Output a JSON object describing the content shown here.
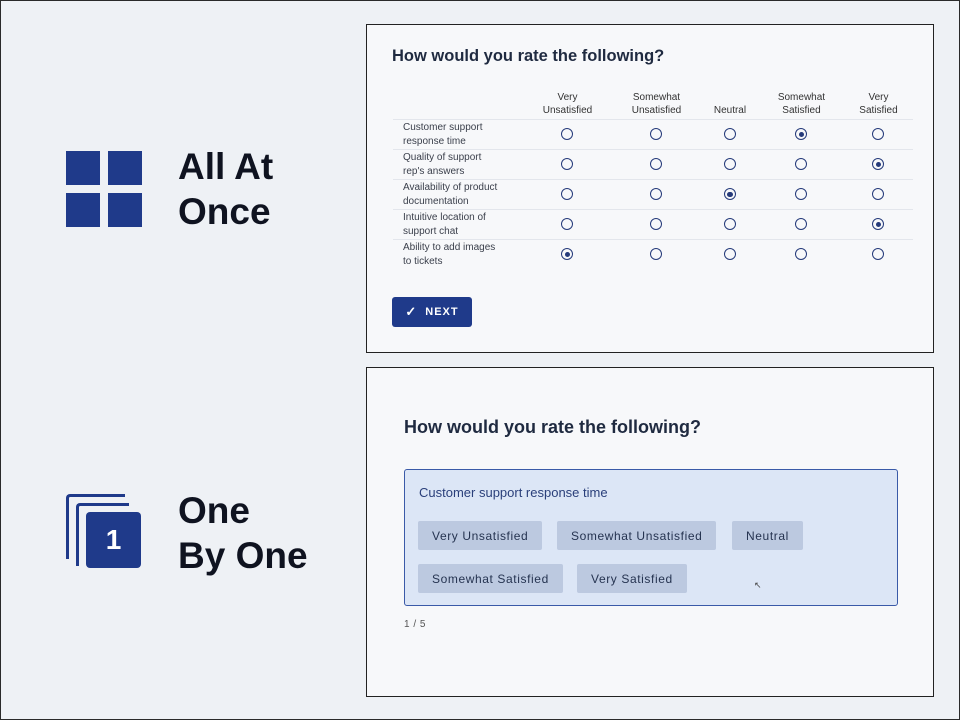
{
  "modes": {
    "all_at_once": {
      "line1": "All At",
      "line2": "Once",
      "icon": "grid-icon"
    },
    "one_by_one": {
      "line1": "One",
      "line2": "By One",
      "icon": "stacked-pages-icon",
      "badge": "1"
    }
  },
  "matrix_survey": {
    "question": "How would you rate the following?",
    "columns": [
      {
        "line1": "Very",
        "line2": "Unsatisfied"
      },
      {
        "line1": "Somewhat",
        "line2": "Unsatisfied"
      },
      {
        "line1": "Neutral",
        "line2": ""
      },
      {
        "line1": "Somewhat",
        "line2": "Satisfied"
      },
      {
        "line1": "Very",
        "line2": "Satisfied"
      }
    ],
    "rows": [
      {
        "line1": "Customer support",
        "line2": "response time",
        "selected": 3
      },
      {
        "line1": "Quality of support",
        "line2": "rep's answers",
        "selected": 4
      },
      {
        "line1": "Availability of product",
        "line2": "documentation",
        "selected": 2
      },
      {
        "line1": "Intuitive location of",
        "line2": "support chat",
        "selected": 4
      },
      {
        "line1": "Ability to add images",
        "line2": "to tickets",
        "selected": 0
      }
    ],
    "next_label": "NEXT",
    "next_icon": "check-icon",
    "accent": "#1f3a8a"
  },
  "single_survey": {
    "question": "How would you rate the following?",
    "item": "Customer support response time",
    "options": [
      "Very Unsatisfied",
      "Somewhat Unsatisfied",
      "Neutral",
      "Somewhat Satisfied",
      "Very Satisfied"
    ],
    "progress": "1 / 5",
    "card_bg": "#dce6f6"
  }
}
